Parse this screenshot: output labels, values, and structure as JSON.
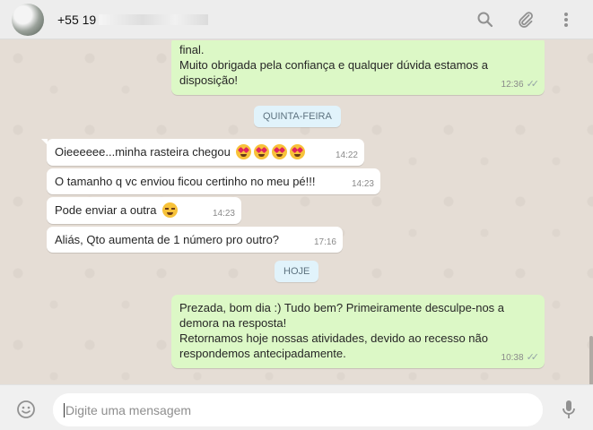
{
  "contact": {
    "name": "+55 19",
    "avatar_icon": "contact-avatar"
  },
  "header_icons": [
    "search-icon",
    "attach-icon",
    "menu-icon"
  ],
  "messages_before": [
    {
      "text": "final.\nMuito obrigada pela confiança e qualquer dúvida estamos a disposição!",
      "time": "12:36",
      "status": "read"
    }
  ],
  "day_labels": {
    "thursday": "QUINTA-FEIRA",
    "today": "HOJE"
  },
  "incoming": [
    {
      "text": "Oieeeeee...minha rasteira chegou",
      "time": "14:22",
      "emoji": "heart-eyes x4"
    },
    {
      "text": "O tamanho q vc enviou ficou certinho no meu pé!!!",
      "time": "14:23"
    },
    {
      "text": "Pode enviar a outra",
      "time": "14:23",
      "emoji": "smirk"
    },
    {
      "text": "Aliás, Qto aumenta de 1 número pro outro?",
      "time": "17:16"
    }
  ],
  "outgoing_today": {
    "text": "Prezada, bom dia :) Tudo bem? Primeiramente desculpe-nos a demora na resposta!\nRetornamos hoje nossas atividades, devido ao recesso não respondemos antecipadamente.",
    "time": "10:38",
    "status": "read"
  },
  "composer": {
    "placeholder": "Digite uma mensagem"
  },
  "colors": {
    "incoming": "#ffffff",
    "outgoing": "#dcf8c6",
    "background": "#e5ddd5",
    "day_chip": "#e1f3fb"
  }
}
